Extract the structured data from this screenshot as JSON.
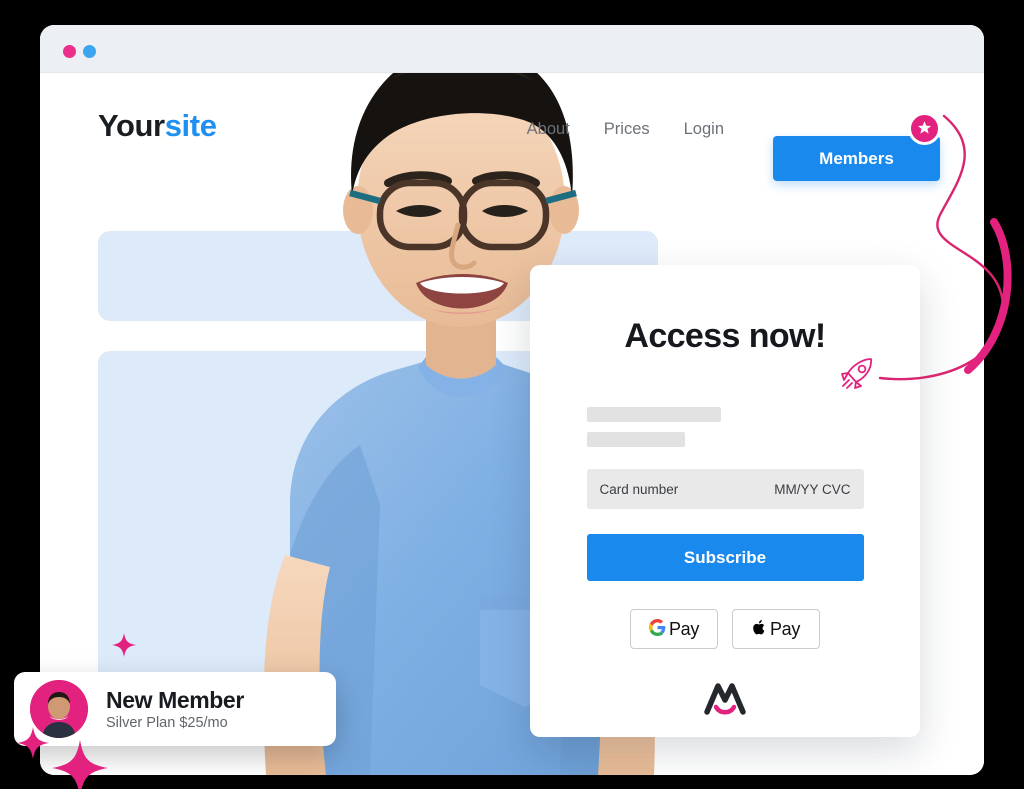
{
  "window": {
    "dots": [
      "window-dot-pink",
      "window-dot-blue"
    ]
  },
  "site": {
    "logo": {
      "part1": "Your",
      "part2": "site"
    },
    "nav": [
      {
        "label": "About",
        "name": "nav-link-about"
      },
      {
        "label": "Prices",
        "name": "nav-link-prices"
      },
      {
        "label": "Login",
        "name": "nav-link-login"
      }
    ],
    "members_button": "Members",
    "badge_icon": "star-icon"
  },
  "modal": {
    "heading": "Access now!",
    "card_number_label": "Card number",
    "card_expiry_label": "MM/YY CVC",
    "subscribe_label": "Subscribe",
    "pay_buttons": [
      {
        "icon": "google-g-icon",
        "label": "Pay",
        "name": "google-pay-button"
      },
      {
        "icon": "apple-icon",
        "label": "Pay",
        "name": "apple-pay-button"
      }
    ],
    "brand_icon": "memberspace-m-logo"
  },
  "toast": {
    "title": "New Member",
    "subtitle": "Silver Plan $25/mo",
    "avatar_icon": "member-avatar"
  },
  "decor": {
    "rocket_icon": "rocket-icon",
    "sparkles": [
      "sparkle-icon",
      "sparkle-icon",
      "sparkle-icon"
    ],
    "curve": "pink-swoosh-line"
  },
  "colors": {
    "accent_blue": "#1989ee",
    "accent_pink": "#e3227f",
    "logo_blue": "#1f90f2",
    "skeleton_blue": "#dceafa",
    "field_gray": "#e9e9e9",
    "background": "#000000"
  }
}
